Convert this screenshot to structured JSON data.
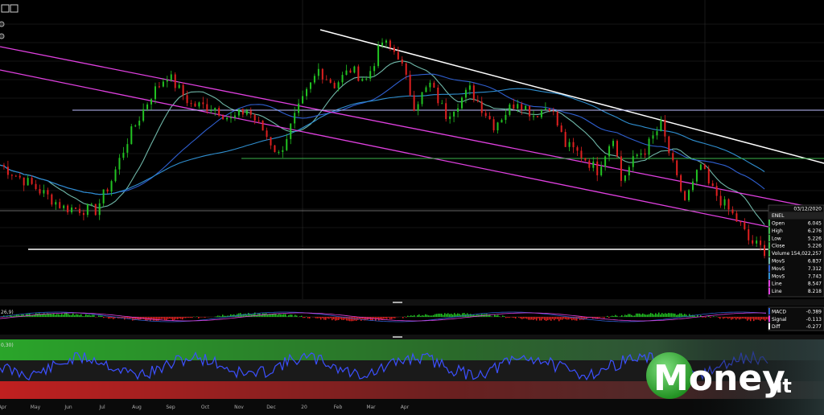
{
  "chart_data": [
    {
      "type": "candlestick",
      "symbol": "ENEL",
      "info_box": {
        "date": "03/12/2020",
        "symbol": "ENEL",
        "rows": [
          {
            "label": "Open",
            "value": "6.045",
            "color": "#3cb44b"
          },
          {
            "label": "High",
            "value": "6.276",
            "color": "#3cb44b"
          },
          {
            "label": "Low",
            "value": "5.226",
            "color": "#3cb44b"
          },
          {
            "label": "Close",
            "value": "5.226",
            "color": "#3cb44b"
          },
          {
            "label": "Volume",
            "value": "154,022,257",
            "color": "#3cb44b"
          },
          {
            "label": "MovS",
            "value": "6.837",
            "color": "#6fb7a8"
          },
          {
            "label": "MovS",
            "value": "7.312",
            "color": "#2f5fd0"
          },
          {
            "label": "MovS",
            "value": "7.743",
            "color": "#2f8fd0"
          },
          {
            "label": "Line",
            "value": "8.547",
            "color": "#e040e0"
          },
          {
            "label": "Line",
            "value": "8.218",
            "color": "#e040e0"
          }
        ]
      },
      "x_tick_labels": [
        "Apr",
        "May",
        "Jun",
        "Jul",
        "Aug",
        "Sep",
        "Oct",
        "Nov",
        "Dec",
        "20",
        "Feb",
        "Mar",
        "Apr"
      ],
      "y_range": [
        5.0,
        10.0
      ],
      "price_path": [
        [
          0,
          7.0
        ],
        [
          4,
          6.6
        ],
        [
          8,
          6.15
        ],
        [
          12,
          6.1
        ],
        [
          14,
          6.7
        ],
        [
          16,
          7.5
        ],
        [
          19,
          8.4
        ],
        [
          21,
          8.8
        ],
        [
          24,
          8.2
        ],
        [
          27,
          8.15
        ],
        [
          29,
          7.9
        ],
        [
          31,
          8.1
        ],
        [
          33,
          7.7
        ],
        [
          35,
          7.2
        ],
        [
          37,
          7.95
        ],
        [
          40,
          8.9
        ],
        [
          42,
          8.6
        ],
        [
          44,
          8.9
        ],
        [
          46,
          8.7
        ],
        [
          48,
          9.45
        ],
        [
          50,
          9.2
        ],
        [
          52,
          8.2
        ],
        [
          54,
          8.6
        ],
        [
          56,
          8.0
        ],
        [
          59,
          8.5
        ],
        [
          62,
          7.8
        ],
        [
          65,
          8.3
        ],
        [
          67,
          8.0
        ],
        [
          69,
          8.2
        ],
        [
          71,
          7.4
        ],
        [
          73,
          7.2
        ],
        [
          75,
          6.9
        ],
        [
          77,
          7.6
        ],
        [
          78,
          6.7
        ],
        [
          80,
          7.2
        ],
        [
          81,
          7.3
        ],
        [
          83,
          7.8
        ],
        [
          85,
          6.7
        ],
        [
          86,
          6.3
        ],
        [
          87,
          6.6
        ],
        [
          88,
          7.0
        ],
        [
          89,
          6.6
        ],
        [
          90,
          6.4
        ],
        [
          91,
          6.2
        ],
        [
          92,
          6.0
        ],
        [
          93,
          5.8
        ],
        [
          94,
          5.5
        ],
        [
          95,
          5.4
        ],
        [
          96,
          5.3
        ]
      ],
      "moving_averages": [
        {
          "label": "MovS",
          "value": 6.837
        },
        {
          "label": "MovS",
          "value": 7.312
        },
        {
          "label": "MovS",
          "value": 7.743
        }
      ],
      "trend_lines": [
        {
          "label": "Line",
          "value": 8.547
        },
        {
          "label": "Line",
          "value": 8.218
        }
      ]
    },
    {
      "type": "macd",
      "label": "26,9)",
      "values": [
        {
          "label": "MACD",
          "value": "-0.389",
          "color": "#2f5fd0"
        },
        {
          "label": "Signal",
          "value": "-0.113",
          "color": "#e040e0"
        },
        {
          "label": "Diff",
          "value": "-0.277",
          "color": "#ffffff"
        }
      ]
    },
    {
      "type": "oscillator",
      "label": "0,30)"
    }
  ],
  "watermark": {
    "brand": "Money",
    "suffix": ".it"
  },
  "colors": {
    "background": "#000000",
    "up": "#22c322",
    "down": "#e02020",
    "trend_magenta": "#e040e0",
    "ma_short": "#6fb7a8",
    "ma_mid": "#2f5fd0",
    "ma_long": "#2f8fd0",
    "oscillator_line": "#3c50ff",
    "logo_green": "#3cc33c"
  }
}
